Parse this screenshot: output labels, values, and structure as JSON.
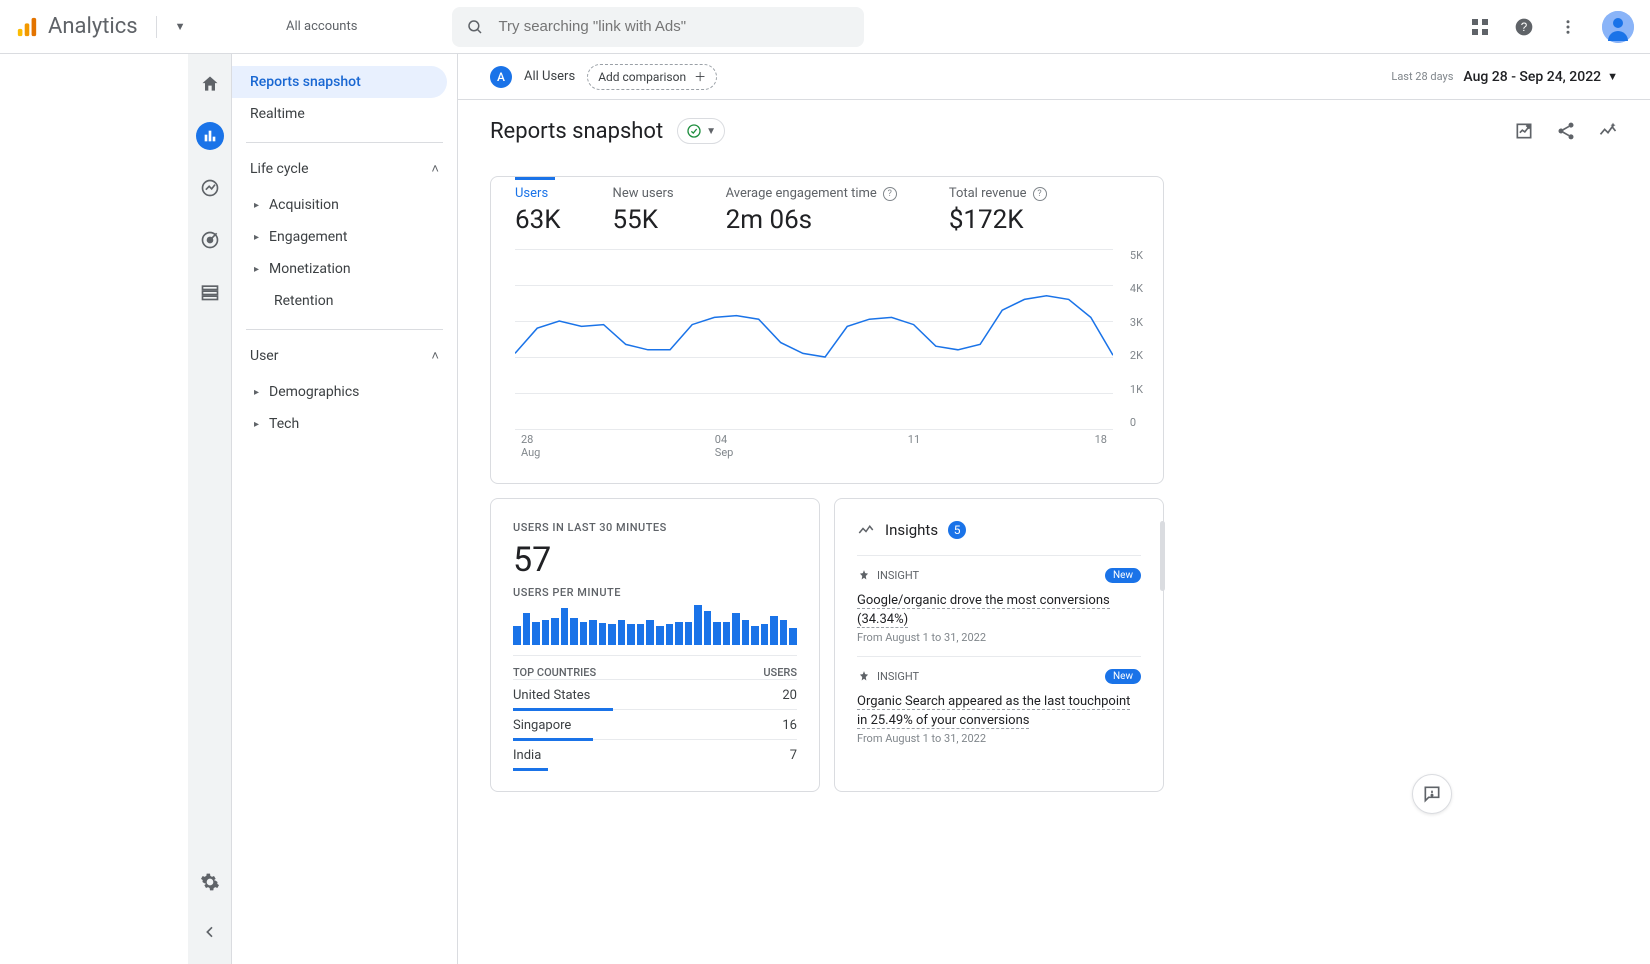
{
  "header": {
    "app_name": "Analytics",
    "accounts_label": "All accounts",
    "search_placeholder": "Try searching \"link with Ads\""
  },
  "left_panel": {
    "item_snapshot": "Reports snapshot",
    "item_realtime": "Realtime",
    "section_lifecycle": "Life cycle",
    "lc_acquisition": "Acquisition",
    "lc_engagement": "Engagement",
    "lc_monetization": "Monetization",
    "lc_retention": "Retention",
    "section_user": "User",
    "u_demographics": "Demographics",
    "u_tech": "Tech"
  },
  "topbar": {
    "segment_letter": "A",
    "segment_label": "All Users",
    "add_comparison": "Add comparison",
    "period_label": "Last 28 days",
    "date_range": "Aug 28 - Sep 24, 2022"
  },
  "page": {
    "title": "Reports snapshot"
  },
  "metrics": {
    "users_label": "Users",
    "users_value": "63K",
    "newusers_label": "New users",
    "newusers_value": "55K",
    "avgeng_label": "Average engagement time",
    "avgeng_value": "2m 06s",
    "revenue_label": "Total revenue",
    "revenue_value": "$172K"
  },
  "chart_data": {
    "type": "line",
    "x": [
      "Aug 28",
      "Aug 29",
      "Aug 30",
      "Aug 31",
      "Sep 01",
      "Sep 02",
      "Sep 03",
      "Sep 04",
      "Sep 05",
      "Sep 06",
      "Sep 07",
      "Sep 08",
      "Sep 09",
      "Sep 10",
      "Sep 11",
      "Sep 12",
      "Sep 13",
      "Sep 14",
      "Sep 15",
      "Sep 16",
      "Sep 17",
      "Sep 18",
      "Sep 19",
      "Sep 20",
      "Sep 21",
      "Sep 22",
      "Sep 23",
      "Sep 24"
    ],
    "values": [
      2100,
      2800,
      3000,
      2850,
      2900,
      2350,
      2200,
      2200,
      2900,
      3100,
      3150,
      3050,
      2400,
      2100,
      2000,
      2850,
      3050,
      3100,
      2900,
      2300,
      2200,
      2350,
      3300,
      3600,
      3700,
      3600,
      3100,
      2050
    ],
    "yticks": [
      0,
      1000,
      2000,
      3000,
      4000,
      5000
    ],
    "ytick_labels": [
      "0",
      "1K",
      "2K",
      "3K",
      "4K",
      "5K"
    ],
    "xtick_labels": [
      {
        "line1": "28",
        "line2": "Aug"
      },
      {
        "line1": "04",
        "line2": "Sep"
      },
      {
        "line1": "11",
        "line2": ""
      },
      {
        "line1": "18",
        "line2": ""
      }
    ],
    "ylabel": "",
    "xlabel": "",
    "title": ""
  },
  "realtime": {
    "title": "USERS IN LAST 30 MINUTES",
    "value": "57",
    "subtitle": "USERS PER MINUTE",
    "bars": [
      18,
      30,
      22,
      24,
      26,
      35,
      26,
      22,
      24,
      21,
      20,
      24,
      20,
      20,
      24,
      18,
      20,
      22,
      22,
      38,
      32,
      22,
      22,
      30,
      24,
      18,
      20,
      28,
      24,
      16
    ],
    "tc_head_left": "TOP COUNTRIES",
    "tc_head_right": "USERS",
    "countries": [
      {
        "name": "United States",
        "users": "20",
        "pct": 100
      },
      {
        "name": "Singapore",
        "users": "16",
        "pct": 80
      },
      {
        "name": "India",
        "users": "7",
        "pct": 35
      }
    ]
  },
  "insights": {
    "header": "Insights",
    "count": "5",
    "tag": "INSIGHT",
    "new": "New",
    "items": [
      {
        "text": "Google/organic drove the most conversions (34.34%)",
        "date": "From August 1 to 31, 2022"
      },
      {
        "text": "Organic Search appeared as the last touchpoint in 25.49% of your conversions",
        "date": "From August 1 to 31, 2022"
      }
    ]
  }
}
